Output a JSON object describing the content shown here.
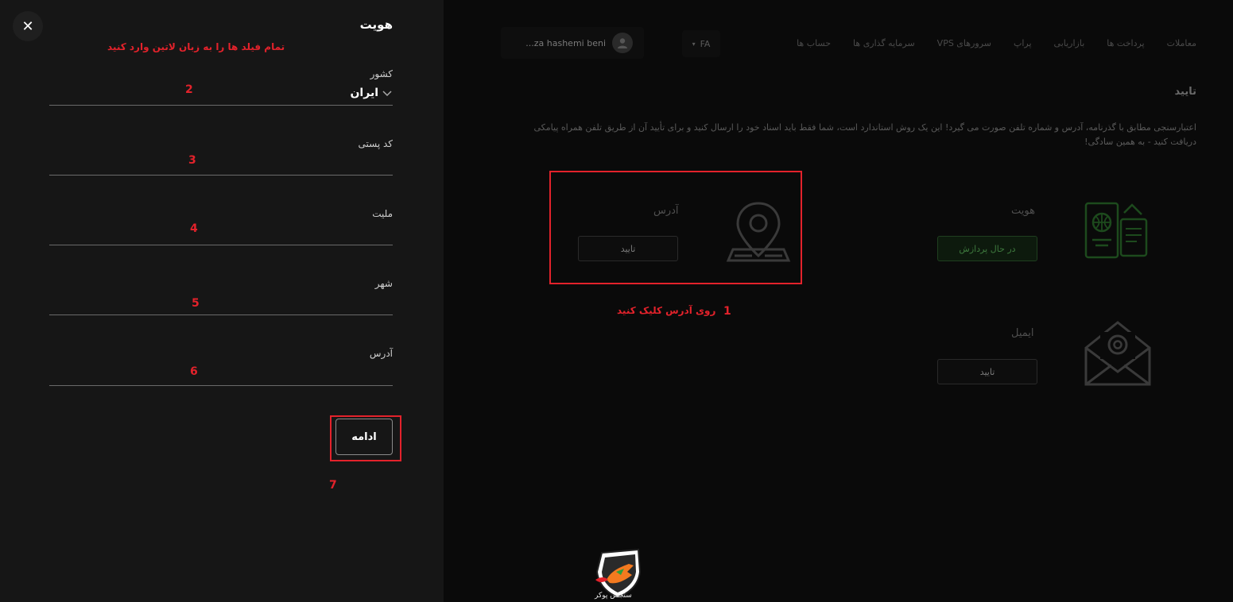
{
  "background_page": {
    "nav": [
      "حساب ها",
      "سرمایه گذاری ها",
      "سرورهای VPS",
      "پراپ",
      "بازاریابی",
      "پرداخت ها",
      "معاملات"
    ],
    "language": "FA",
    "user_name": "...za hashemi beni",
    "section_title": "تایید",
    "description": "اعتبارسنجی مطابق با گذرنامه، آدرس و شماره تلفن صورت می گیرد! این یک روش استاندارد است، شما فقط باید اسناد خود را ارسال کنید و برای تأیید آن از طریق تلفن همراه پیامکی دریافت کنید - به همین سادگی!",
    "cards": {
      "identity": {
        "title": "هویت",
        "button": "در حال پردازش",
        "icon": "passport-icon"
      },
      "address": {
        "title": "آدرس",
        "button": "تایید",
        "icon": "map-pin-icon"
      },
      "email": {
        "title": "ایمیل",
        "button": "تایید",
        "icon": "envelope-at-icon"
      }
    }
  },
  "annotations": {
    "step1_number": "1",
    "step1_text": "روی آدرس کلیک کنید",
    "step2": "2",
    "step3": "3",
    "step4": "4",
    "step5": "5",
    "step6": "6",
    "step7": "7",
    "latin_note": "تمام فیلد ها را به زبان لاتین وارد کنید",
    "color": "#e3222b"
  },
  "drawer": {
    "title": "هویت",
    "fields": {
      "country": {
        "label": "کشور",
        "value": "ایران"
      },
      "postal_code": {
        "label": "کد پستی",
        "value": ""
      },
      "nationality": {
        "label": "ملیت",
        "value": ""
      },
      "city": {
        "label": "شهر",
        "value": ""
      },
      "address": {
        "label": "آدرس",
        "value": ""
      }
    },
    "continue_button": "ادامه"
  },
  "watermark": {
    "text": "سنجس پوکر"
  }
}
